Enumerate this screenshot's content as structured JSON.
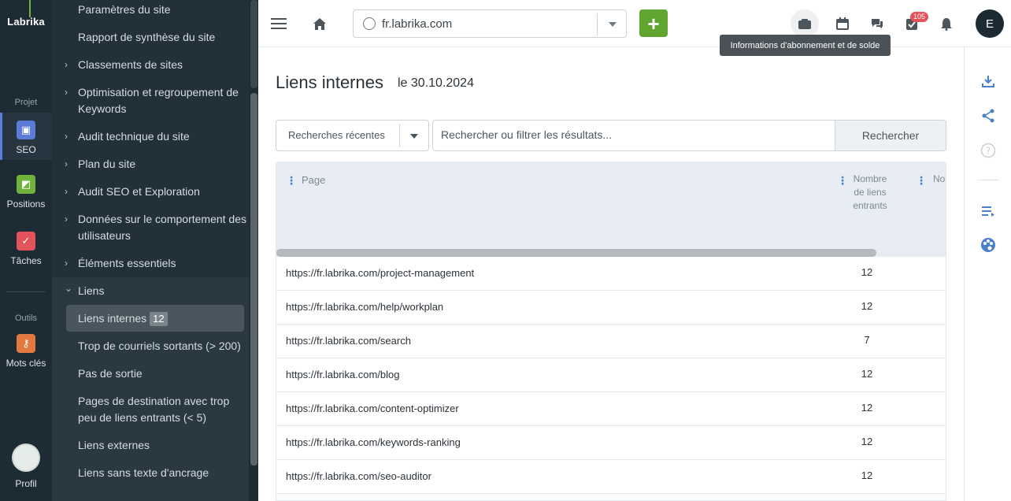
{
  "rail": {
    "logo": "Labrika",
    "section_projet": "Projet",
    "section_outils": "Outils",
    "items": [
      {
        "label": "SEO",
        "icon": "seo-icon",
        "color": "#5a7bd6"
      },
      {
        "label": "Positions",
        "icon": "chart-icon",
        "color": "#6fb33d"
      },
      {
        "label": "Tâches",
        "icon": "check-icon",
        "color": "#e2535b"
      },
      {
        "label": "Mots clés",
        "icon": "key-icon",
        "color": "#e27a3f"
      }
    ],
    "profile_label": "Profil"
  },
  "sidebar": {
    "items": [
      {
        "label": "Paramètres du site",
        "chevron": ""
      },
      {
        "label": "Rapport de synthèse du site",
        "chevron": ""
      },
      {
        "label": "Classements de sites",
        "chevron": "›"
      },
      {
        "label": "Optimisation et regroupement de Keywords",
        "chevron": "›"
      },
      {
        "label": "Audit technique du site",
        "chevron": "›"
      },
      {
        "label": "Plan du site",
        "chevron": "›"
      },
      {
        "label": "Audit SEO et Exploration",
        "chevron": "›"
      },
      {
        "label": "Données sur le comportement des utilisateurs",
        "chevron": "›"
      },
      {
        "label": "Éléments essentiels",
        "chevron": "›"
      },
      {
        "label": "Liens",
        "chevron": "⌄"
      }
    ],
    "sub_items": [
      {
        "label": "Liens internes",
        "badge": "12"
      },
      {
        "label": "Trop de courriels sortants (> 200)"
      },
      {
        "label": "Pas de sortie"
      },
      {
        "label": "Pages de destination avec trop peu de liens entrants (< 5)"
      },
      {
        "label": "Liens externes"
      },
      {
        "label": "Liens sans texte d'ancrage"
      }
    ]
  },
  "topbar": {
    "site_url": "fr.labrika.com",
    "add_label": "+",
    "notification_count": "105",
    "user_initial": "E",
    "tooltip": "Informations d'abonnement et de solde"
  },
  "main": {
    "title": "Liens internes",
    "date": "le 30.10.2024",
    "recent_searches": "Recherches récentes",
    "search_placeholder": "Rechercher ou filtrer les résultats...",
    "search_button": "Rechercher",
    "columns": {
      "page": "Page",
      "count": "Nombre de liens entrants",
      "next": "No"
    },
    "rows": [
      {
        "url": "https://fr.labrika.com/project-management",
        "count": "12"
      },
      {
        "url": "https://fr.labrika.com/help/workplan",
        "count": "12"
      },
      {
        "url": "https://fr.labrika.com/search",
        "count": "7"
      },
      {
        "url": "https://fr.labrika.com/blog",
        "count": "12"
      },
      {
        "url": "https://fr.labrika.com/content-optimizer",
        "count": "12"
      },
      {
        "url": "https://fr.labrika.com/keywords-ranking",
        "count": "12"
      },
      {
        "url": "https://fr.labrika.com/seo-auditor",
        "count": "12"
      }
    ]
  }
}
